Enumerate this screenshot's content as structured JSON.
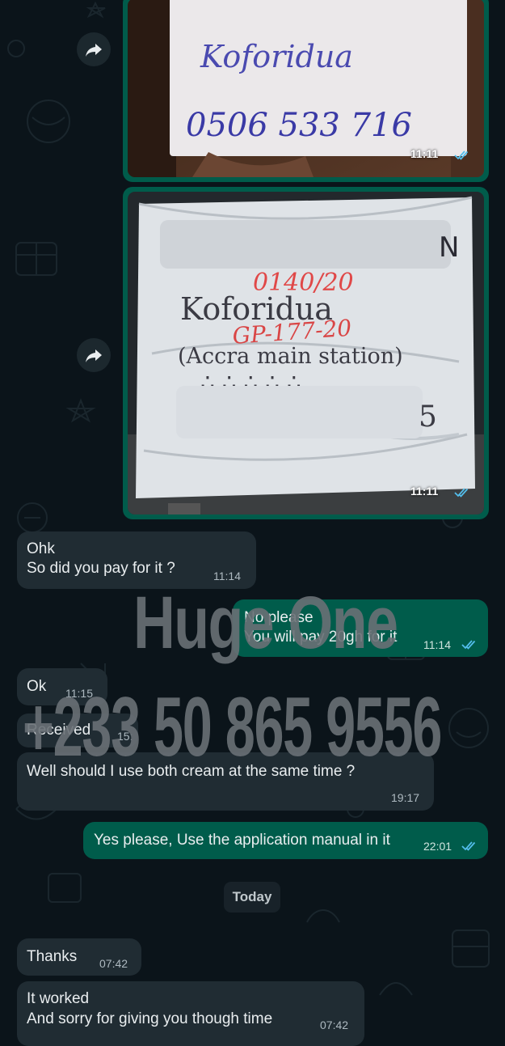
{
  "photos": [
    {
      "handwriting": [
        "Koforidua",
        "0506 533 716"
      ],
      "time": "11:11"
    },
    {
      "handwriting": [
        "Koforidua",
        "(Accra main station)",
        "GP-177-20",
        "0140/20",
        "N",
        "5"
      ],
      "time": "11:11"
    }
  ],
  "messages": [
    {
      "direction": "in",
      "lines": [
        "Ohk",
        "So did you pay for it ?"
      ],
      "time": "11:14"
    },
    {
      "direction": "out",
      "lines": [
        "No please",
        "You will pay 20gh for it"
      ],
      "time": "11:14",
      "ticks": "read"
    },
    {
      "direction": "in",
      "lines": [
        "Ok"
      ],
      "time": "11:15"
    },
    {
      "direction": "in",
      "lines": [
        "Received"
      ],
      "time": "15:"
    },
    {
      "direction": "in",
      "lines": [
        "Well should I use both cream at the same time ?"
      ],
      "time": "19:17"
    },
    {
      "direction": "out",
      "lines": [
        "Yes please, Use the application manual in it"
      ],
      "time": "22:01",
      "ticks": "read"
    },
    {
      "direction": "in",
      "lines": [
        "Thanks"
      ],
      "time": "07:42"
    },
    {
      "direction": "in",
      "lines": [
        "It worked",
        "And sorry for giving you though time"
      ],
      "time": "07:42"
    }
  ],
  "date_divider": "Today",
  "watermark": {
    "title": "Huge One",
    "phone": "+233 50 865 9556"
  },
  "icons": {
    "forward": "forward-icon",
    "read_receipt": "double-check-icon"
  },
  "colors": {
    "background": "#0b141a",
    "incoming_bubble": "#202c33",
    "outgoing_bubble": "#005c4b",
    "read_ticks": "#53bdeb",
    "watermark": "#697075"
  }
}
